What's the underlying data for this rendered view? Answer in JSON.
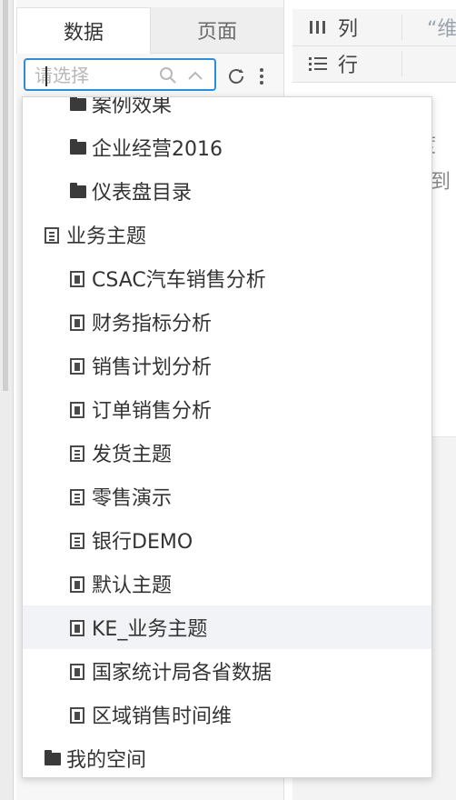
{
  "panel": {
    "tabs": [
      {
        "label": "数据",
        "active": true
      },
      {
        "label": "页面",
        "active": false
      }
    ],
    "search": {
      "placeholder": "请选择",
      "value": ""
    }
  },
  "right": {
    "columns_label": "列",
    "rows_label": "行",
    "extra_quote": "“维",
    "fragments": [
      "'度",
      "拖到"
    ]
  },
  "tree": [
    {
      "label": "案例效果",
      "type": "folder",
      "level": 2
    },
    {
      "label": "企业经营2016",
      "type": "folder",
      "level": 2
    },
    {
      "label": "仪表盘目录",
      "type": "folder",
      "level": 2
    },
    {
      "label": "业务主题",
      "type": "theme",
      "level": 1
    },
    {
      "label": "CSAC汽车销售分析",
      "type": "theme-item",
      "level": 2
    },
    {
      "label": "财务指标分析",
      "type": "theme-item",
      "level": 2
    },
    {
      "label": "销售计划分析",
      "type": "theme-item",
      "level": 2
    },
    {
      "label": "订单销售分析",
      "type": "theme-item",
      "level": 2
    },
    {
      "label": "发货主题",
      "type": "theme",
      "level": 2
    },
    {
      "label": "零售演示",
      "type": "theme",
      "level": 2
    },
    {
      "label": "银行DEMO",
      "type": "theme",
      "level": 2
    },
    {
      "label": "默认主题",
      "type": "theme-item",
      "level": 2
    },
    {
      "label": "KE_业务主题",
      "type": "theme-item",
      "level": 2,
      "highlighted": true
    },
    {
      "label": "国家统计局各省数据",
      "type": "theme-item",
      "level": 2
    },
    {
      "label": "区域销售时间维",
      "type": "theme-item",
      "level": 2
    },
    {
      "label": "我的空间",
      "type": "folder",
      "level": 1
    }
  ],
  "colors": {
    "accent": "#2f8dd8",
    "hover": "#f1f3f6"
  }
}
